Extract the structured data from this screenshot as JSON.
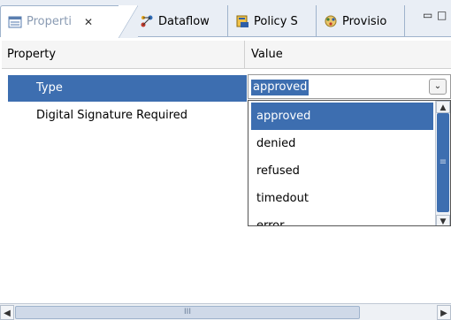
{
  "tabs": [
    {
      "label": "Properti",
      "icon": "properties-icon",
      "close": "✕"
    },
    {
      "label": "Dataflow",
      "icon": "dataflow-icon"
    },
    {
      "label": "Policy S",
      "icon": "policy-icon"
    },
    {
      "label": "Provisio",
      "icon": "provisioning-icon"
    }
  ],
  "window_controls": {
    "minimize": "▭",
    "maximize": "□"
  },
  "table": {
    "header_property": "Property",
    "header_value": "Value",
    "rows": [
      {
        "name": "Type",
        "value": "approved",
        "selected": true
      },
      {
        "name": "Digital Signature Required"
      }
    ]
  },
  "dropdown": {
    "options": [
      "approved",
      "denied",
      "refused",
      "timedout",
      "error"
    ],
    "selected": "approved"
  },
  "scroll": {
    "up": "▲",
    "down": "▼",
    "left": "◀",
    "right": "▶",
    "grip_h": "III",
    "grip_v": "≡"
  },
  "colors": {
    "selection": "#3d6eb0",
    "tab_bar": "#e9eef5"
  }
}
